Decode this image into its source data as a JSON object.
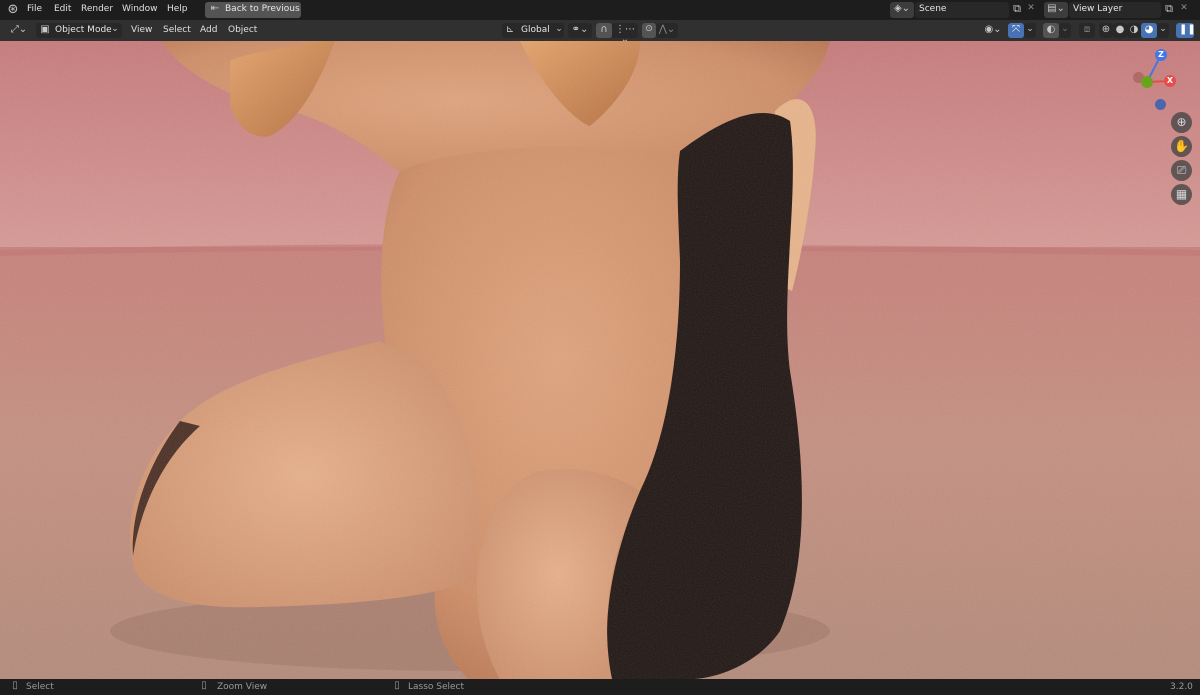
{
  "topbar": {
    "menus": [
      "File",
      "Edit",
      "Render",
      "Window",
      "Help"
    ],
    "back_button": "Back to Previous",
    "scene": "Scene",
    "view_layer": "View Layer"
  },
  "header": {
    "mode": "Object Mode",
    "menus": [
      "View",
      "Select",
      "Add",
      "Object"
    ],
    "orientation": "Global"
  },
  "gizmo": {
    "z": "Z",
    "x": "X"
  },
  "status": {
    "select": "Select",
    "zoom": "Zoom View",
    "lasso": "Lasso Select",
    "version": "3.2.0"
  },
  "icons": [
    "blender-logo-icon",
    "back-arrow-icon",
    "scene-icon",
    "copy-icon",
    "close-icon",
    "view-layer-icon",
    "editor-type-icon",
    "object-mode-icon",
    "transform-orientation-icon",
    "pivot-icon",
    "snap-icon",
    "proportional-icon",
    "visibility-icon",
    "gizmo-icon",
    "overlay-icon",
    "xray-icon",
    "shading-wireframe-icon",
    "shading-solid-icon",
    "shading-material-icon",
    "shading-rendered-icon",
    "pause-icon",
    "zoom-icon",
    "hand-icon",
    "camera-icon",
    "grid-icon",
    "mouse-left-icon",
    "mouse-middle-icon"
  ],
  "colors": {
    "accent": "#4772b3",
    "x_axis": "#e64c4c",
    "y_axis": "#6aa41c",
    "z_axis": "#4477e5"
  }
}
